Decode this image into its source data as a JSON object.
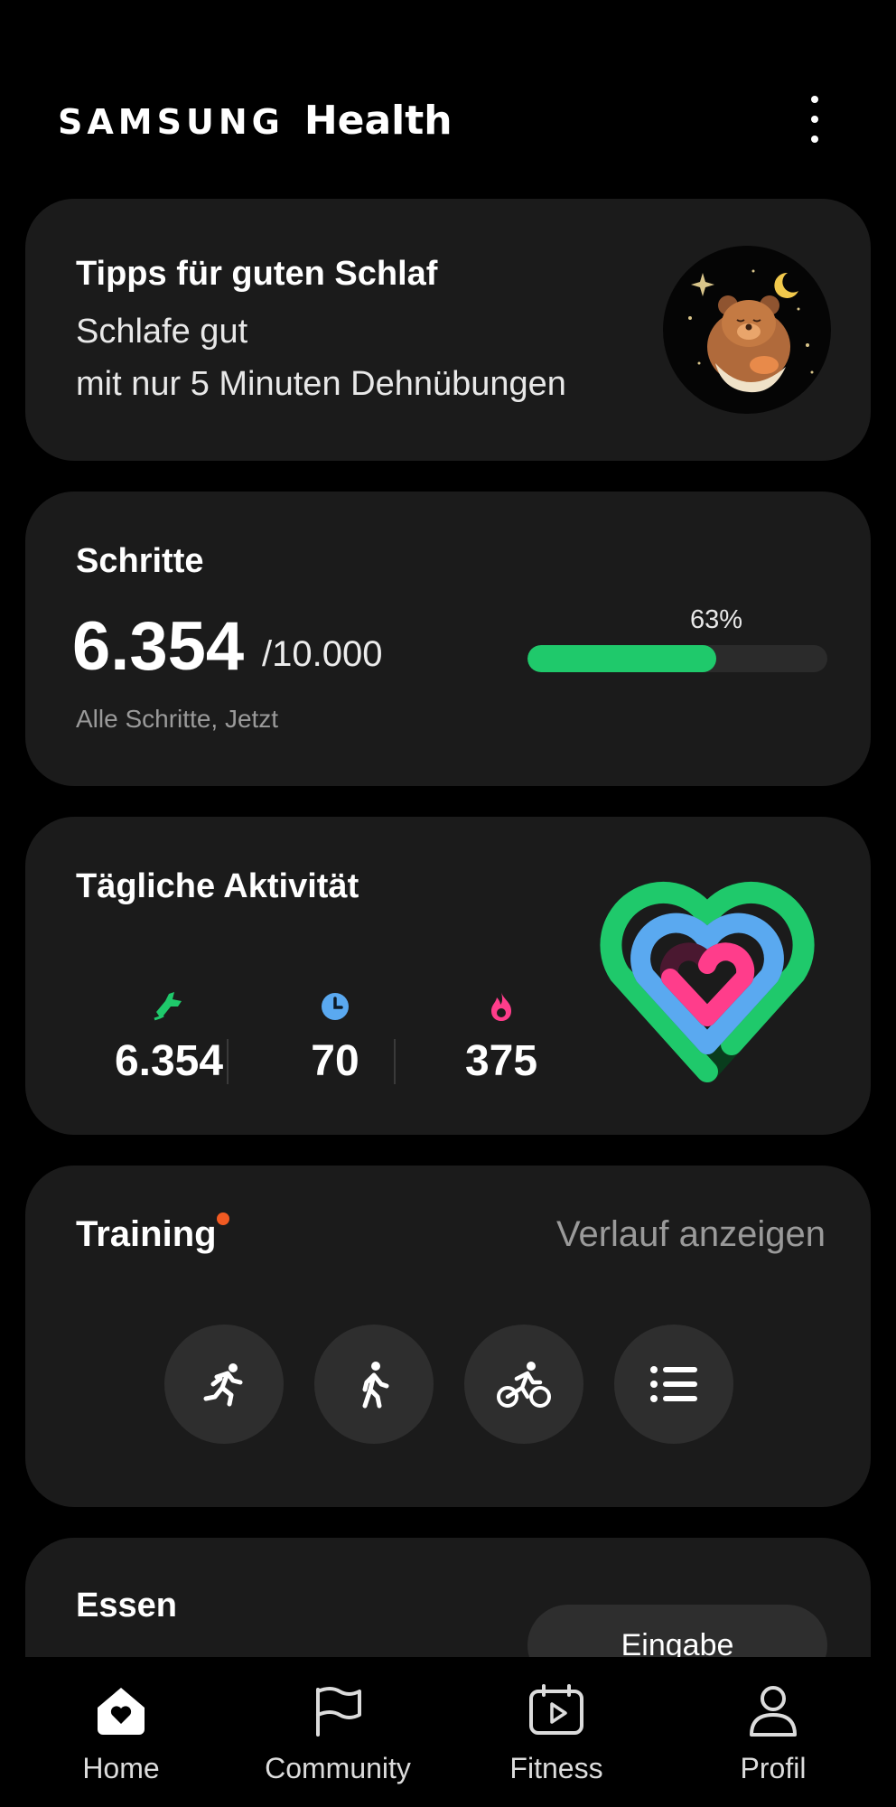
{
  "header": {
    "brand_samsung": "SAMSUNG",
    "brand_health": "Health",
    "menu_icon": "more-vertical-icon"
  },
  "sleep_card": {
    "title": "Tipps für guten Schlaf",
    "line1": "Schlafe gut",
    "line2": "mit nur 5 Minuten Dehnübungen",
    "illustration": "sleeping-bear-illustration"
  },
  "steps_card": {
    "title": "Schritte",
    "value": "6.354",
    "goal": "/10.000",
    "subtitle": "Alle Schritte, Jetzt",
    "percent_label": "63%",
    "progress": 0.63,
    "bar_color": "#1fc96b"
  },
  "activity_card": {
    "title": "Tägliche Aktivität",
    "stats": [
      {
        "icon": "shoe-icon",
        "value": "6.354",
        "color": "#1fc96b"
      },
      {
        "icon": "clock-icon",
        "value": "70",
        "color": "#5aa9f0"
      },
      {
        "icon": "flame-icon",
        "value": "375",
        "color": "#ff3d8b"
      }
    ],
    "rings_icon": "activity-heart-rings-icon"
  },
  "training_card": {
    "title": "Training",
    "history_link": "Verlauf anzeigen",
    "notification_color": "#f15a22",
    "buttons": [
      {
        "icon": "running-icon"
      },
      {
        "icon": "walking-icon"
      },
      {
        "icon": "cycling-icon"
      },
      {
        "icon": "list-icon"
      }
    ]
  },
  "food_card": {
    "title": "Essen",
    "entry_button": "Eingabe"
  },
  "nav": {
    "items": [
      {
        "label": "Home",
        "icon": "home-heart-icon",
        "active": true
      },
      {
        "label": "Community",
        "icon": "flag-icon",
        "active": false
      },
      {
        "label": "Fitness",
        "icon": "play-calendar-icon",
        "active": false
      },
      {
        "label": "Profil",
        "icon": "person-icon",
        "active": false
      }
    ]
  }
}
